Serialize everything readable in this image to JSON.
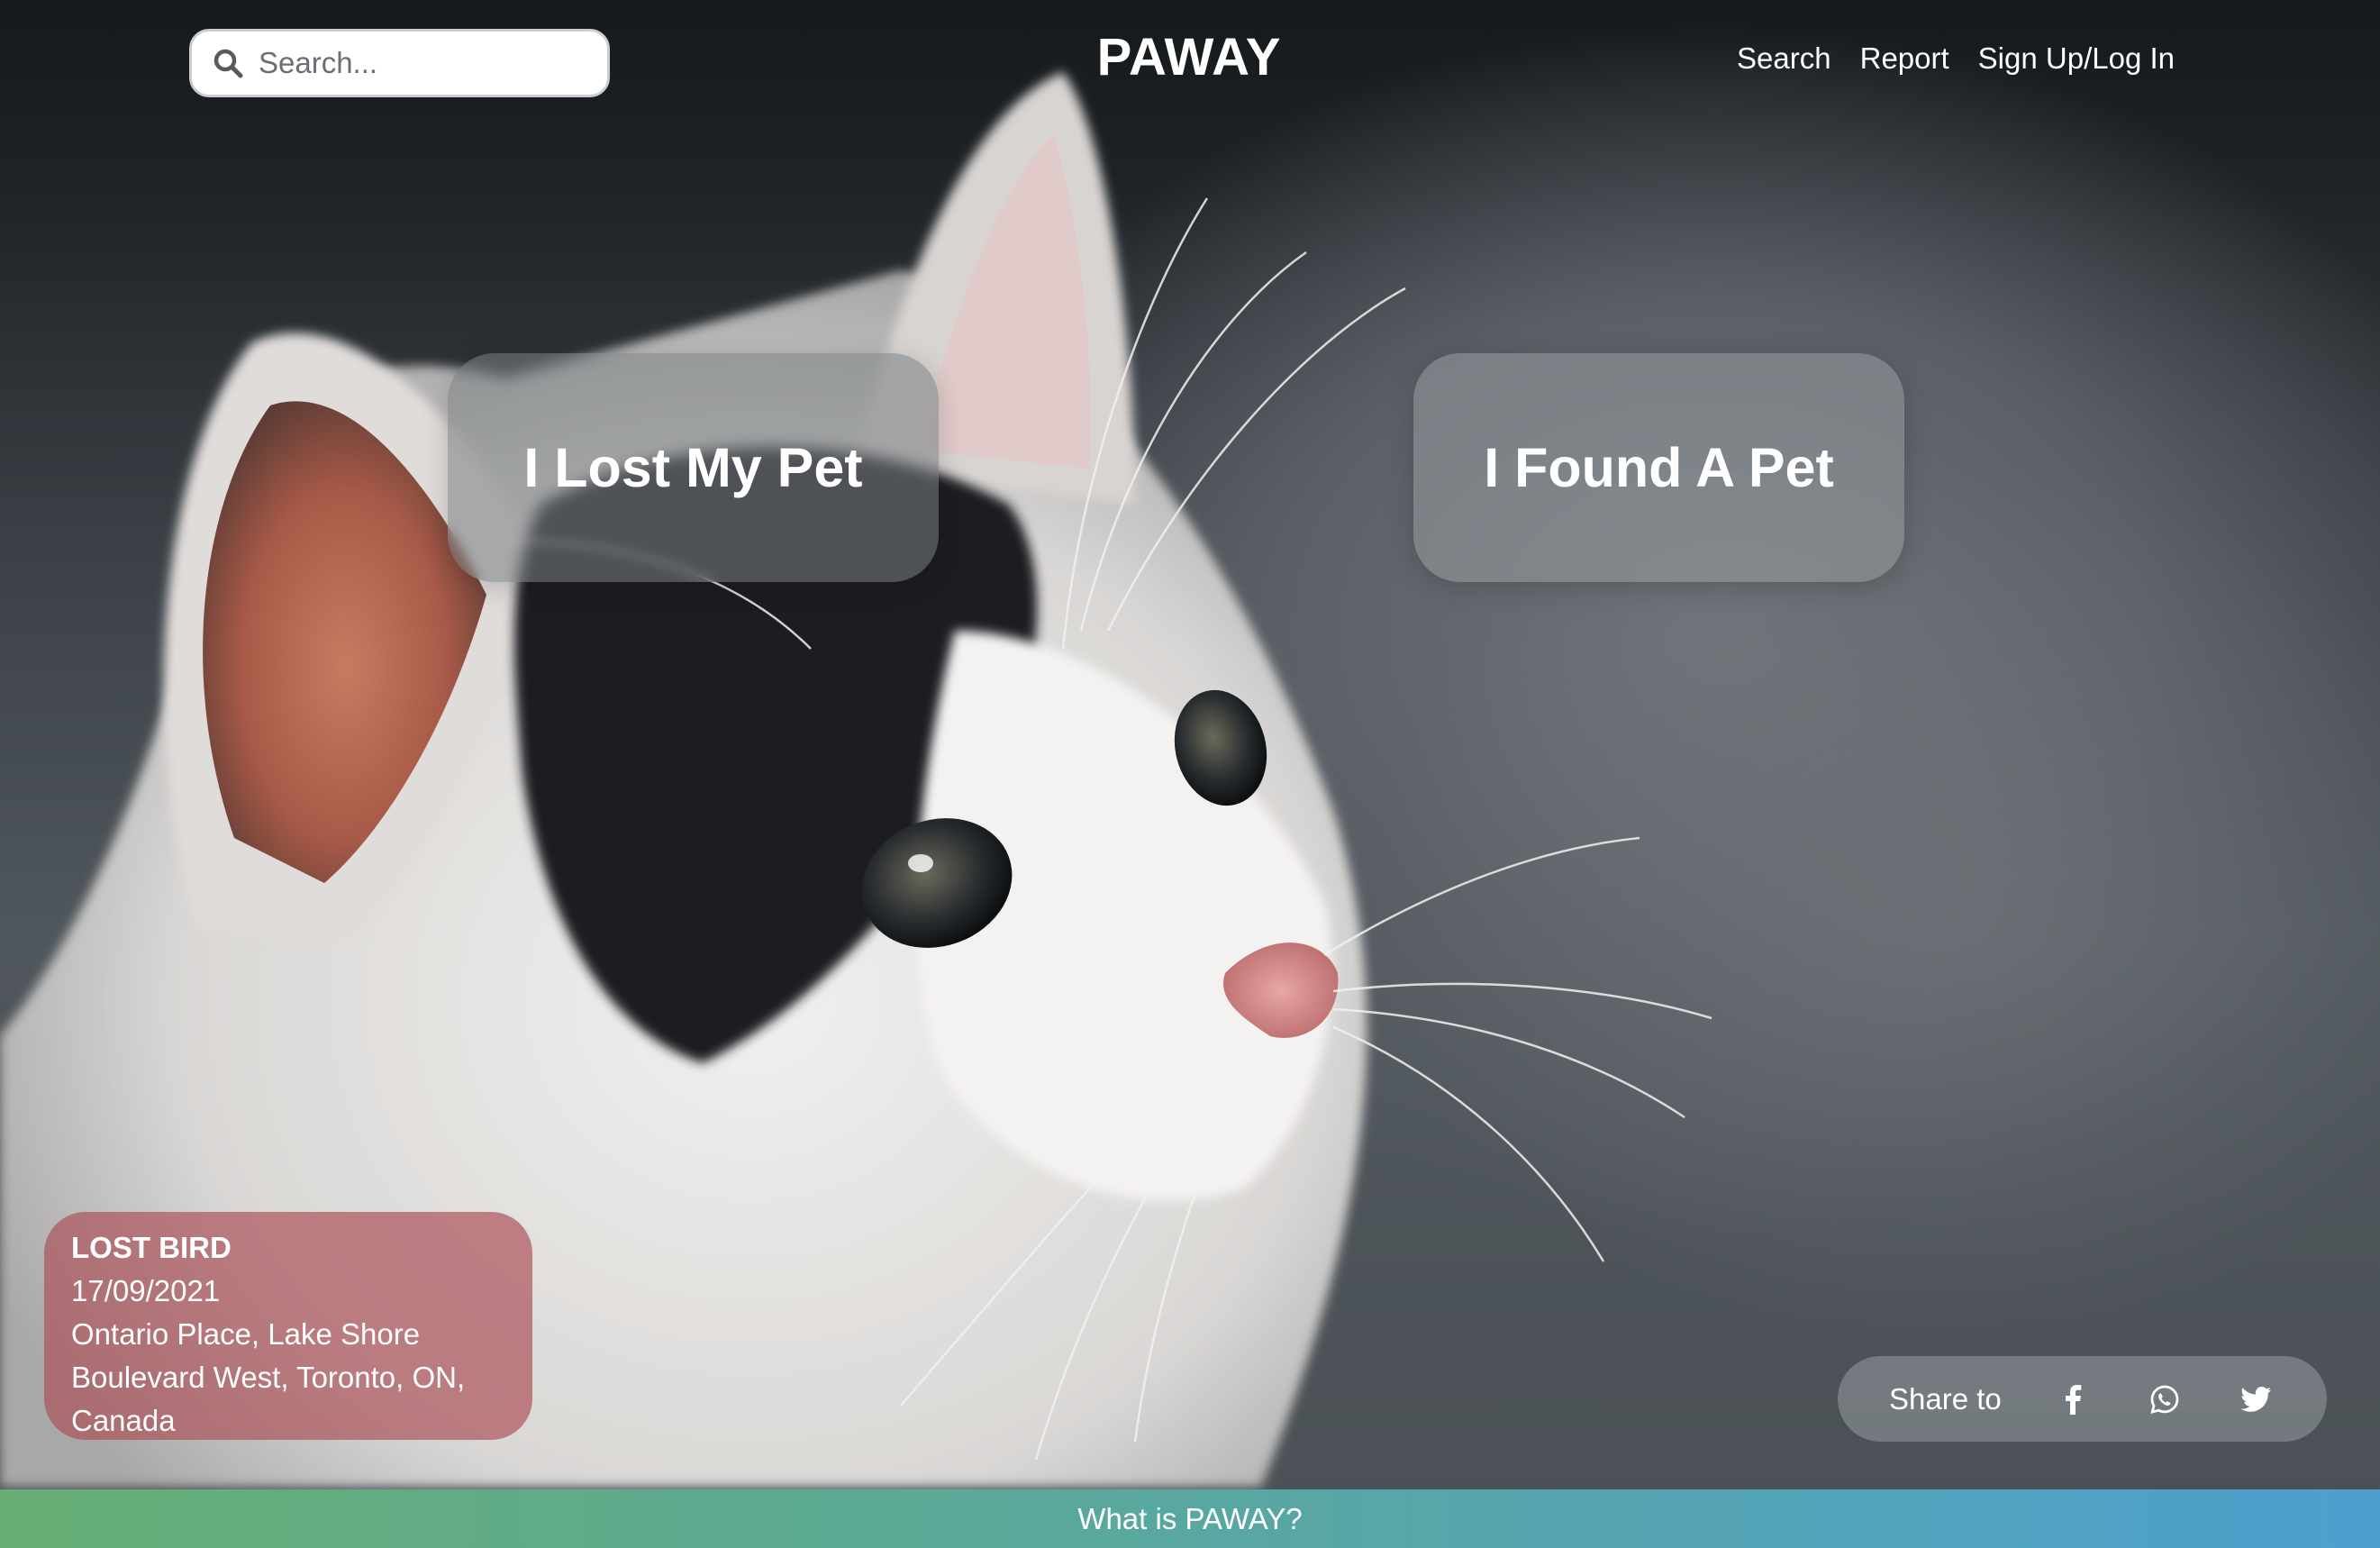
{
  "header": {
    "search_placeholder": "Search...",
    "brand": "PAWAY",
    "nav": [
      "Search",
      "Report",
      "Sign Up/Log In"
    ]
  },
  "hero": {
    "lost_label": "I Lost My Pet",
    "found_label": "I Found A Pet"
  },
  "lost_card": {
    "title": "LOST BIRD",
    "date": "17/09/2021",
    "location_line1": "Ontario Place, Lake Shore",
    "location_line2": "Boulevard West, Toronto, ON,",
    "location_line3": "Canada"
  },
  "share": {
    "label": "Share to",
    "icons": [
      "facebook-icon",
      "whatsapp-icon",
      "twitter-icon"
    ]
  },
  "footer": {
    "label": "What is PAWAY?"
  },
  "colors": {
    "card_red": "#aa5055",
    "footer_start": "#66ae74",
    "footer_end": "#4d9fcf"
  }
}
